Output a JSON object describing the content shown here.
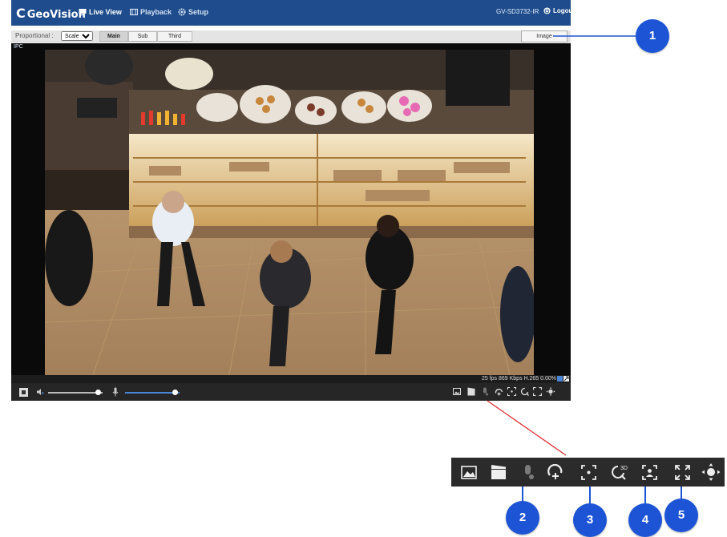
{
  "header": {
    "logo": "GeoVision",
    "nav": [
      {
        "label": "Live View",
        "icon": "monitor-icon",
        "active": true
      },
      {
        "label": "Playback",
        "icon": "film-icon",
        "active": false
      },
      {
        "label": "Setup",
        "icon": "gear-icon",
        "active": false
      }
    ],
    "model": "GV-SD3732-IR",
    "logout": "Logout"
  },
  "toolbar": {
    "proportional_label": "Proportional :",
    "proportional_value": "Scale",
    "stream_tabs": [
      "Main",
      "Sub",
      "Third"
    ],
    "selected_stream": "Main",
    "image_button": "Image"
  },
  "video": {
    "channel_label": "IPC",
    "status": "25 fps  869 Kbps    H.265    0.00%"
  },
  "controls": {
    "speaker_volume": 0.8,
    "mic_volume": 0.8
  },
  "callouts": [
    "1",
    "2",
    "3",
    "4",
    "5"
  ],
  "colors": {
    "header_bg": "#1e4c8c",
    "callout": "#1d54d6",
    "pointer_line": "#e0242a"
  }
}
